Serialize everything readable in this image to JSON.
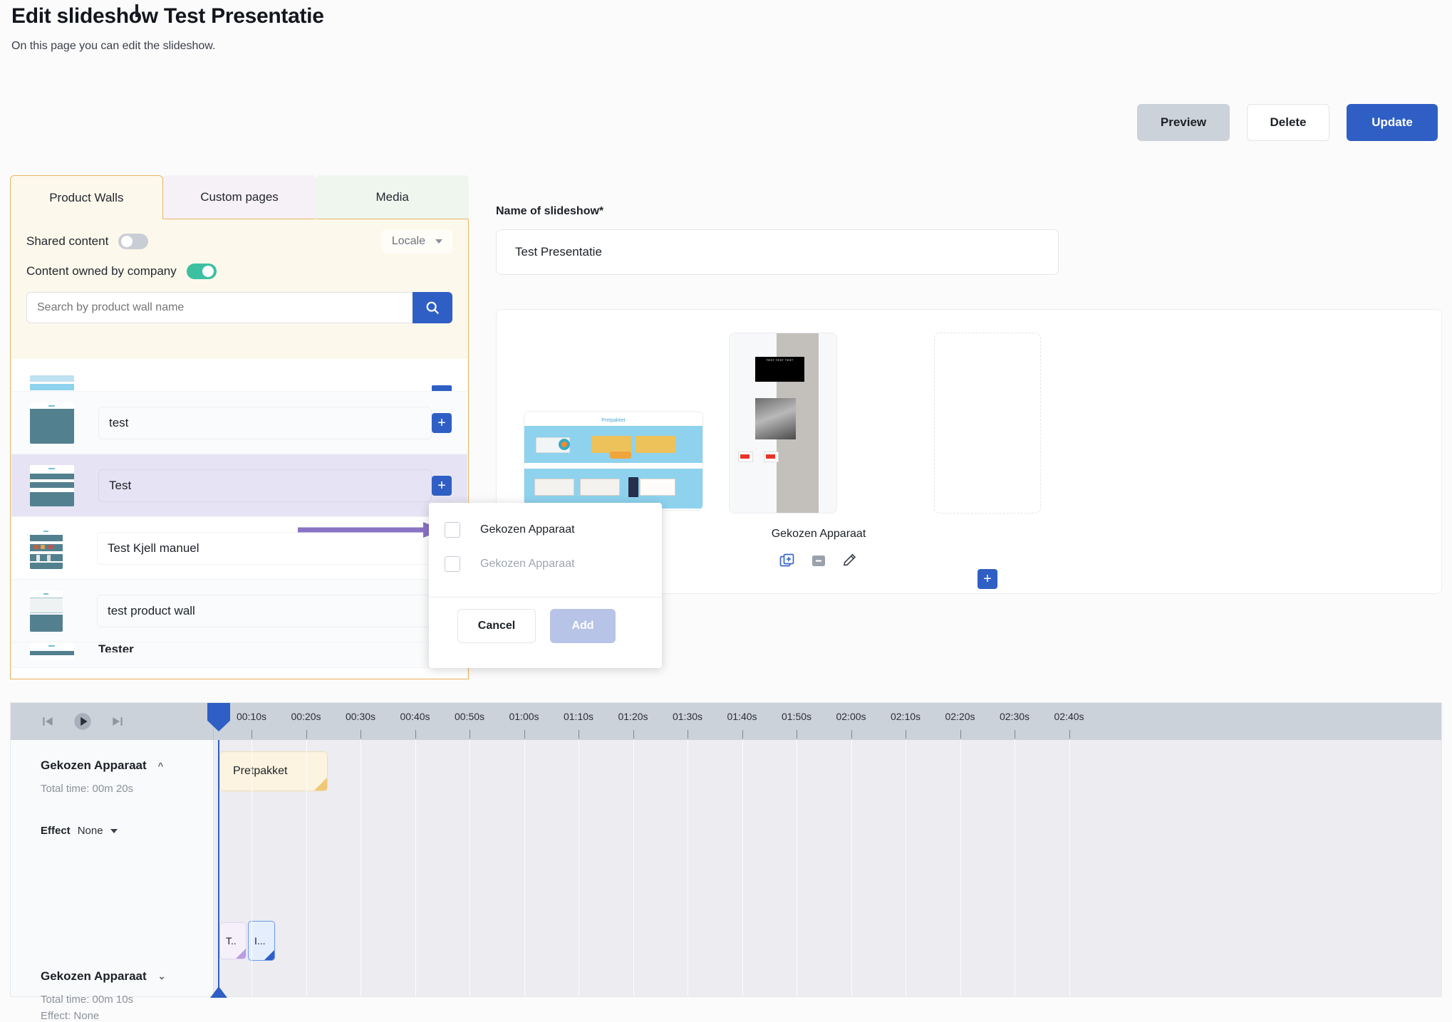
{
  "header": {
    "title": "Edit slideshow Test Presentatie",
    "subtitle": "On this page you can edit the slideshow."
  },
  "actions": {
    "preview": "Preview",
    "delete": "Delete",
    "update": "Update"
  },
  "left_panel": {
    "tabs": [
      {
        "label": "Product Walls",
        "active": true
      },
      {
        "label": "Custom pages",
        "active": false
      },
      {
        "label": "Media",
        "active": false
      }
    ],
    "shared_content_label": "Shared content",
    "shared_content_on": false,
    "content_owned_label": "Content owned by company",
    "content_owned_on": true,
    "locale_label": "Locale",
    "search_placeholder": "Search by product wall name",
    "search_value": "",
    "rows": [
      {
        "name": "test"
      },
      {
        "name": "Test"
      },
      {
        "name": "Test Kjell manuel"
      },
      {
        "name": "test product wall"
      },
      {
        "name": "Tester"
      }
    ]
  },
  "popup": {
    "items": [
      {
        "label": "Gekozen Apparaat",
        "checked": false,
        "dim": false
      },
      {
        "label": "Gekozen Apparaat",
        "checked": false,
        "dim": true
      }
    ],
    "cancel": "Cancel",
    "add": "Add"
  },
  "slideshow": {
    "name_label": "Name of slideshow*",
    "name_value": "Test Presentatie",
    "slides": [
      {
        "caption": "Gekozen Apparaat",
        "wall_title": "Pretpakket"
      },
      {
        "caption": "Gekozen Apparaat",
        "device_text": "TEST TEST TEST"
      }
    ],
    "add_slide_label": "+"
  },
  "timeline": {
    "ticks": [
      "00:10s",
      "00:20s",
      "00:30s",
      "00:40s",
      "00:50s",
      "01:00s",
      "01:10s",
      "01:20s",
      "01:30s",
      "01:40s",
      "01:50s",
      "02:00s",
      "02:10s",
      "02:20s",
      "02:30s",
      "02:40s"
    ],
    "tracks": [
      {
        "title": "Gekozen Apparaat",
        "total_time": "Total time: 00m 20s",
        "effect_label": "Effect",
        "effect_value": "None",
        "expanded": true,
        "clips": [
          {
            "label": "Pretpakket"
          }
        ]
      },
      {
        "title": "Gekozen Apparaat",
        "total_time": "Total time: 00m 10s",
        "effect_line": "Effect: None",
        "expanded": false,
        "clips": [
          {
            "label": "T.."
          },
          {
            "label": "I..."
          }
        ]
      }
    ]
  },
  "colors": {
    "accent_blue": "#2f5fc4",
    "toggle_on": "#3cc0a0",
    "panel_border": "#eab464",
    "selected_row": "#e6e4f4"
  }
}
